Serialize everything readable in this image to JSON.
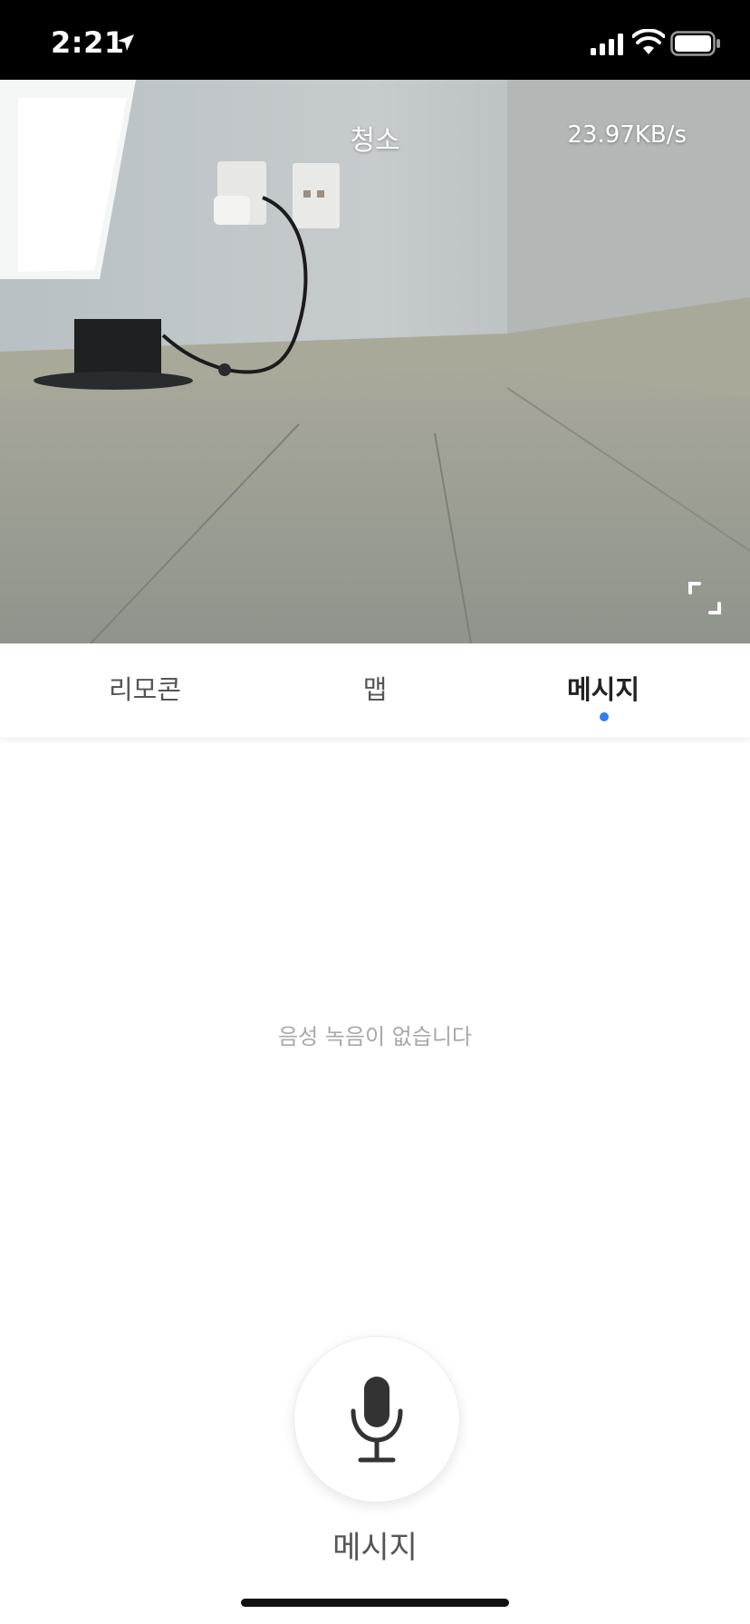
{
  "status_bar": {
    "time": "2:21"
  },
  "header": {
    "title": "청소",
    "speed": "23.97KB/s"
  },
  "tabs": [
    {
      "label": "리모콘",
      "active": false
    },
    {
      "label": "맵",
      "active": false
    },
    {
      "label": "메시지",
      "active": true
    }
  ],
  "empty_state": {
    "text": "음성 녹음이 없습니다"
  },
  "record": {
    "label": "메시지"
  },
  "colors": {
    "accent": "#2f7cf6",
    "status_bar_bg": "#000000"
  },
  "icons": {
    "back": "chevron-left-icon",
    "fullscreen": "fullscreen-icon",
    "mic": "microphone-icon"
  }
}
